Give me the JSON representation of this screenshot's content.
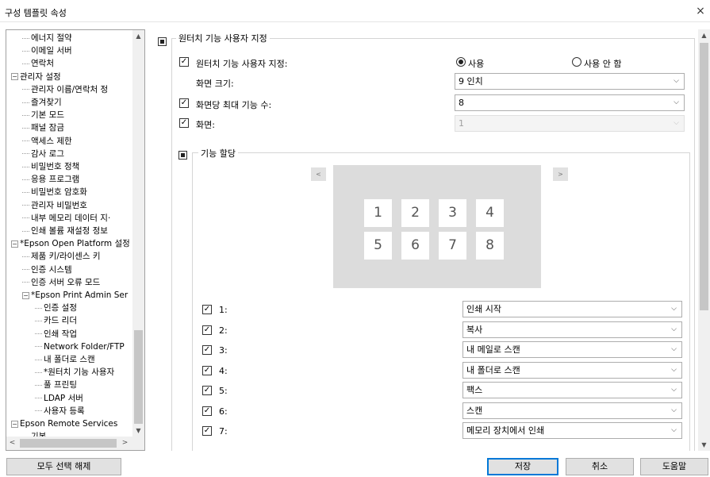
{
  "window": {
    "title": "구성 템플릿 속성",
    "close_glyph": "×"
  },
  "tree": {
    "items": [
      {
        "label": "에너지 절약",
        "indent": 2,
        "type": "leaf"
      },
      {
        "label": "이메일 서버",
        "indent": 2,
        "type": "leaf"
      },
      {
        "label": "연락처",
        "indent": 2,
        "type": "leaf"
      },
      {
        "label": "관리자 설정",
        "indent": 1,
        "type": "expanded"
      },
      {
        "label": "관리자 이름/연락처 정",
        "indent": 2,
        "type": "leaf"
      },
      {
        "label": "즐겨찾기",
        "indent": 2,
        "type": "leaf"
      },
      {
        "label": "기본 모드",
        "indent": 2,
        "type": "leaf"
      },
      {
        "label": "패널 잠금",
        "indent": 2,
        "type": "leaf"
      },
      {
        "label": "액세스 제한",
        "indent": 2,
        "type": "leaf"
      },
      {
        "label": "감사 로그",
        "indent": 2,
        "type": "leaf"
      },
      {
        "label": "비밀번호 정책",
        "indent": 2,
        "type": "leaf"
      },
      {
        "label": "응용 프로그램",
        "indent": 2,
        "type": "leaf"
      },
      {
        "label": "비밀번호 암호화",
        "indent": 2,
        "type": "leaf"
      },
      {
        "label": "관리자 비밀번호",
        "indent": 2,
        "type": "leaf"
      },
      {
        "label": "내부 메모리 데이터 지·",
        "indent": 2,
        "type": "leaf"
      },
      {
        "label": "인쇄 볼륨 재설정 정보",
        "indent": 2,
        "type": "leaf"
      },
      {
        "label": "*Epson Open Platform 설정",
        "indent": 1,
        "type": "expanded"
      },
      {
        "label": "제품 키/라이센스 키",
        "indent": 2,
        "type": "leaf"
      },
      {
        "label": "인증 시스템",
        "indent": 2,
        "type": "leaf"
      },
      {
        "label": "인증 서버 오류 모드",
        "indent": 2,
        "type": "leaf"
      },
      {
        "label": "*Epson Print Admin Ser",
        "indent": 2,
        "type": "expanded"
      },
      {
        "label": "인증 설정",
        "indent": 3,
        "type": "leaf"
      },
      {
        "label": "카드 리더",
        "indent": 3,
        "type": "leaf"
      },
      {
        "label": "인쇄 작업",
        "indent": 3,
        "type": "leaf"
      },
      {
        "label": "Network Folder/FTP",
        "indent": 3,
        "type": "leaf"
      },
      {
        "label": "내 폴더로 스캔",
        "indent": 3,
        "type": "leaf"
      },
      {
        "label": "*원터치 기능 사용자",
        "indent": 3,
        "type": "leaf",
        "selected": true
      },
      {
        "label": "풀 프린팅",
        "indent": 3,
        "type": "leaf"
      },
      {
        "label": "LDAP 서버",
        "indent": 3,
        "type": "leaf"
      },
      {
        "label": "사용자 등록",
        "indent": 3,
        "type": "leaf"
      },
      {
        "label": "Epson Remote Services",
        "indent": 1,
        "type": "expanded"
      },
      {
        "label": "기본",
        "indent": 2,
        "type": "leaf"
      }
    ]
  },
  "settings": {
    "group_title": "원터치 기능 사용자 지정",
    "enable": {
      "label": "원터치 기능 사용자 지정:",
      "checked": true,
      "radio_on": "사용",
      "radio_off": "사용 안 함"
    },
    "screen_size": {
      "label": "화면 크기:",
      "value": "9 인치"
    },
    "max_functions": {
      "label": "화면당 최대 기능 수:",
      "value": "8",
      "checked": true
    },
    "screen": {
      "label": "화면:",
      "value": "1",
      "checked": true
    },
    "assign_group_title": "기능 할당",
    "nav_prev": "<",
    "nav_next": ">",
    "preview_keys": [
      "1",
      "2",
      "3",
      "4",
      "5",
      "6",
      "7",
      "8"
    ],
    "assignments": [
      {
        "label": "1:",
        "value": "인쇄 시작"
      },
      {
        "label": "2:",
        "value": "복사"
      },
      {
        "label": "3:",
        "value": "내 메일로 스캔"
      },
      {
        "label": "4:",
        "value": "내 폴더로 스캔"
      },
      {
        "label": "5:",
        "value": "팩스"
      },
      {
        "label": "6:",
        "value": "스캔"
      },
      {
        "label": "7:",
        "value": "메모리 장치에서 인쇄"
      }
    ]
  },
  "footer": {
    "deselect_all": "모두 선택 해제",
    "save": "저장",
    "cancel": "취소",
    "help": "도움말"
  },
  "glyphs": {
    "check": "✓",
    "chevron": "⌵",
    "up": "▲",
    "down": "▼",
    "left": "<",
    "right": ">",
    "minus": "−"
  }
}
